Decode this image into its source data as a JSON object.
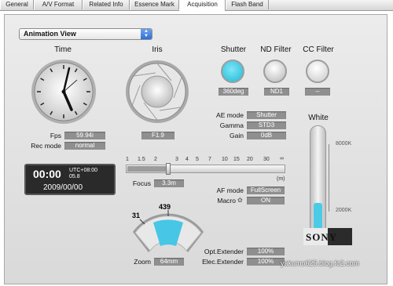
{
  "tabs": [
    "General",
    "A/V Format",
    "Related Info",
    "Essence Mark",
    "Acquisition",
    "Flash Band"
  ],
  "view_select": "Animation View",
  "sections": {
    "time": "Time",
    "iris": "Iris",
    "shutter": "Shutter",
    "nd_filter": "ND Filter",
    "cc_filter": "CC Filter",
    "white": "White"
  },
  "shutter_value": "360deg",
  "nd_value": "ND1",
  "cc_value": "--",
  "fps_label": "Fps",
  "fps_value": "59.94i",
  "rec_label": "Rec mode",
  "rec_value": "normal",
  "iris_value": "F1.9",
  "ae_label": "AE mode",
  "ae_value": "Shutter",
  "gamma_label": "Gamma",
  "gamma_value": "STD3",
  "gain_label": "Gain",
  "gain_value": "0dB",
  "tc_time": "00:00",
  "tc_zone": "UTC+08:00",
  "tc_sub": "05.8",
  "tc_date": "2009/00/00",
  "focus_ticks": [
    "1",
    "1.5",
    "2",
    "3",
    "4",
    "5",
    "7",
    "10",
    "15",
    "20",
    "30",
    "∞"
  ],
  "focus_unit": "(m)",
  "focus_label": "Focus",
  "focus_value": "3.3m",
  "af_label": "AF mode",
  "af_value": "FullScreen",
  "macro_label": "Macro",
  "macro_value": "ON",
  "zoom_min": "31",
  "zoom_max": "439",
  "zoom_label": "Zoom",
  "zoom_value": "64mm",
  "opt_label": "Opt.Extender",
  "opt_value": "100%",
  "elec_label": "Elec.Extender",
  "elec_value": "100%",
  "white_high": "8000K",
  "white_low": "2000K",
  "white_level": 0.27,
  "logo": "SONY",
  "watermark": "yakumo625.blog.fc2.com",
  "colors": {
    "accent": "#2fc8e6",
    "value_bg": "#8f8f8f"
  }
}
